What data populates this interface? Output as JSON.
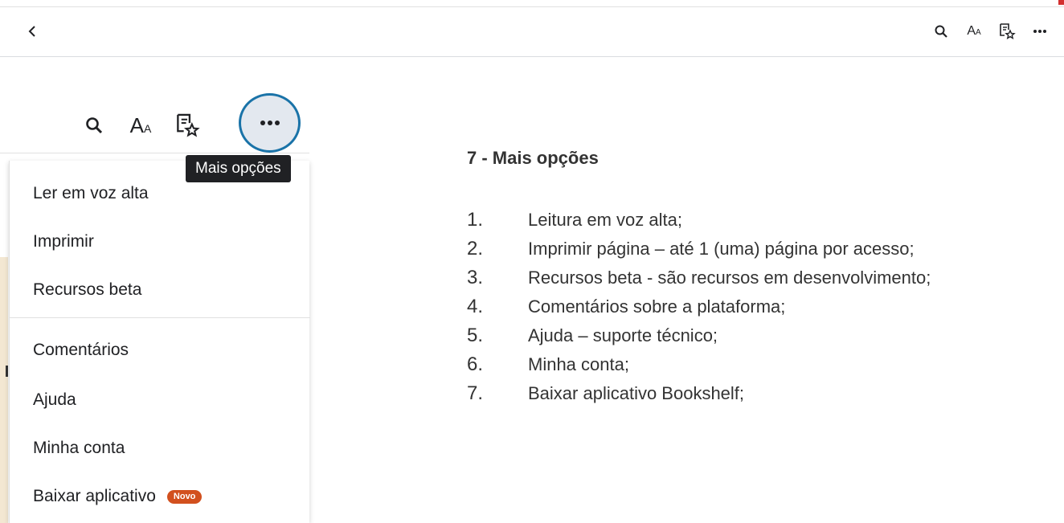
{
  "toolbar": {
    "back_icon": "chevron-left-icon",
    "icons": [
      "search-icon",
      "font-size-icon",
      "bookmark-list-icon",
      "more-horizontal-icon"
    ],
    "aa_main": "A",
    "aa_sup": "A"
  },
  "zoomed": {
    "aa_main": "A",
    "aa_sup": "A",
    "tooltip": "Mais opções"
  },
  "menu": {
    "items": [
      {
        "label": "Ler em voz alta"
      },
      {
        "label": "Imprimir"
      },
      {
        "label": "Recursos beta"
      },
      {
        "label": "Comentários"
      },
      {
        "label": "Ajuda"
      },
      {
        "label": "Minha conta"
      },
      {
        "label": "Baixar aplicativo"
      }
    ],
    "badge": "Novo",
    "badge_color": "#d2501e"
  },
  "description": {
    "title": "7 - Mais opções",
    "items": [
      {
        "num": "1.",
        "text": "Leitura em voz alta;"
      },
      {
        "num": "2.",
        "text": "Imprimir página – até 1 (uma) página por acesso;"
      },
      {
        "num": "3.",
        "text": "Recursos beta - são recursos em desenvolvimento;"
      },
      {
        "num": "4.",
        "text": "Comentários sobre a plataforma;"
      },
      {
        "num": "5.",
        "text": "Ajuda – suporte técnico;"
      },
      {
        "num": "6.",
        "text": "Minha conta;"
      },
      {
        "num": "7.",
        "text": "Baixar aplicativo Bookshelf;"
      }
    ]
  },
  "colors": {
    "highlight_ring": "#1a73a8",
    "highlight_fill": "#e3e8ef",
    "tooltip_bg": "#202124"
  }
}
